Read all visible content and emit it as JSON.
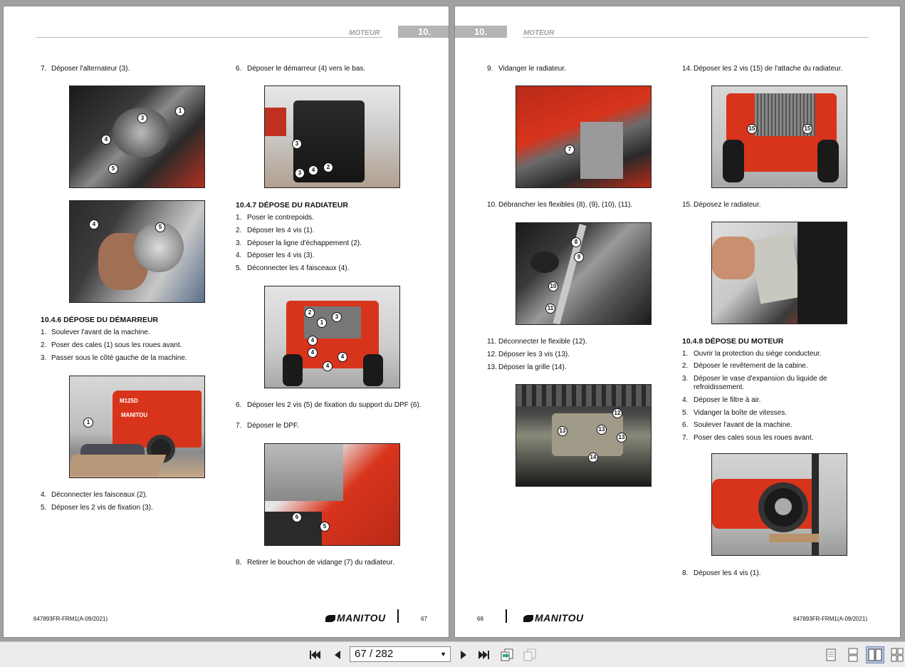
{
  "header": {
    "left_title": "MOTEUR",
    "right_title": "MOTEUR",
    "chapter": "10."
  },
  "left_page": {
    "col1": {
      "step7": {
        "num": "7.",
        "text": "Déposer l'alternateur (3)."
      },
      "heading": "10.4.6 DÉPOSE DU DÉMARREUR",
      "steps": [
        {
          "num": "1.",
          "text": "Soulever l'avant de la machine."
        },
        {
          "num": "2.",
          "text": "Poser des cales (1) sous les roues avant."
        },
        {
          "num": "3.",
          "text": "Passer sous le côté gauche de la machine."
        }
      ],
      "steps2": [
        {
          "num": "4.",
          "text": "Déconnecter les faisceaux (2)."
        },
        {
          "num": "5.",
          "text": "Déposer les 2 vis de fixation (3)."
        }
      ]
    },
    "col2": {
      "step6": {
        "num": "6.",
        "text": "Déposer le démarreur (4) vers le bas."
      },
      "heading": "10.4.7 DÉPOSE DU RADIATEUR",
      "steps": [
        {
          "num": "1.",
          "text": "Poser le contrepoids."
        },
        {
          "num": "2.",
          "text": "Déposer les 4 vis (1)."
        },
        {
          "num": "3.",
          "text": "Déposer la ligne d'échappement (2)."
        },
        {
          "num": "4.",
          "text": "Déposer les 4 vis (3)."
        },
        {
          "num": "5.",
          "text": "Déconnecter les 4 faisceaux (4)."
        }
      ],
      "steps2": [
        {
          "num": "6.",
          "text": "Déposer les 2 vis (5) de fixation du support du DPF (6)."
        },
        {
          "num": "7.",
          "text": "Déposer le DPF."
        }
      ],
      "step8": {
        "num": "8.",
        "text": "Retirer le bouchon de vidange (7) du radiateur."
      }
    },
    "footer": {
      "code": "647893FR-FRM1(A-09/2021)",
      "logo": "MANITOU",
      "page": "67"
    }
  },
  "right_page": {
    "col1": {
      "step9": {
        "num": "9.",
        "text": "Vidanger le radiateur."
      },
      "step10": {
        "num": "10.",
        "text": "Débrancher les flexibles (8), (9), (10), (11)."
      },
      "steps": [
        {
          "num": "11.",
          "text": "Déconnecter le flexible (12)."
        },
        {
          "num": "12.",
          "text": "Déposer les 3 vis (13)."
        },
        {
          "num": "13.",
          "text": "Déposer la grille (14)."
        }
      ]
    },
    "col2": {
      "step14": {
        "num": "14.",
        "text": "Déposer les 2 vis (15) de l'attache du radiateur."
      },
      "step15": {
        "num": "15.",
        "text": "Déposez le radiateur."
      },
      "heading": "10.4.8 DÉPOSE DU MOTEUR",
      "steps": [
        {
          "num": "1.",
          "text": "Ouvrir la protection du siège conducteur."
        },
        {
          "num": "2.",
          "text": "Déposer le revêtement de la cabine."
        },
        {
          "num": "3.",
          "text": "Déposer le vase d'expansion du liquide de refroidissement."
        },
        {
          "num": "4.",
          "text": "Déposer le filtre à air."
        },
        {
          "num": "5.",
          "text": "Vidanger la boîte de vitesses."
        },
        {
          "num": "6.",
          "text": "Soulever l'avant de la machine."
        },
        {
          "num": "7.",
          "text": "Poser des cales sous les roues avant."
        }
      ],
      "step8": {
        "num": "8.",
        "text": "Déposer les 4 vis (1)."
      }
    },
    "footer": {
      "code": "647893FR-FRM1(A-09/2021)",
      "logo": "MANITOU",
      "page": "68"
    }
  },
  "callouts": {
    "alt1": [
      "1",
      "3",
      "4",
      "5"
    ],
    "alt2": [
      "4",
      "5"
    ],
    "starter": [
      "3",
      "3",
      "4",
      "2"
    ],
    "forklift": [
      "1"
    ],
    "rad_rear": [
      "2",
      "3",
      "1",
      "4",
      "4",
      "4",
      "4"
    ],
    "dpf": [
      "6",
      "5"
    ],
    "drain": [
      "7"
    ],
    "hoses": [
      "8",
      "9",
      "10",
      "11"
    ],
    "grille": [
      "12",
      "13",
      "13",
      "13",
      "14"
    ],
    "attach": [
      "15",
      "15"
    ],
    "forklift_label": "M125D",
    "forklift_brand": "MANITOU"
  },
  "toolbar": {
    "page_display": "67 / 282"
  },
  "colors": {
    "accent": "#d8341c",
    "header_box": "#b4b4b4",
    "viewer_bg": "#a0a0a0"
  }
}
